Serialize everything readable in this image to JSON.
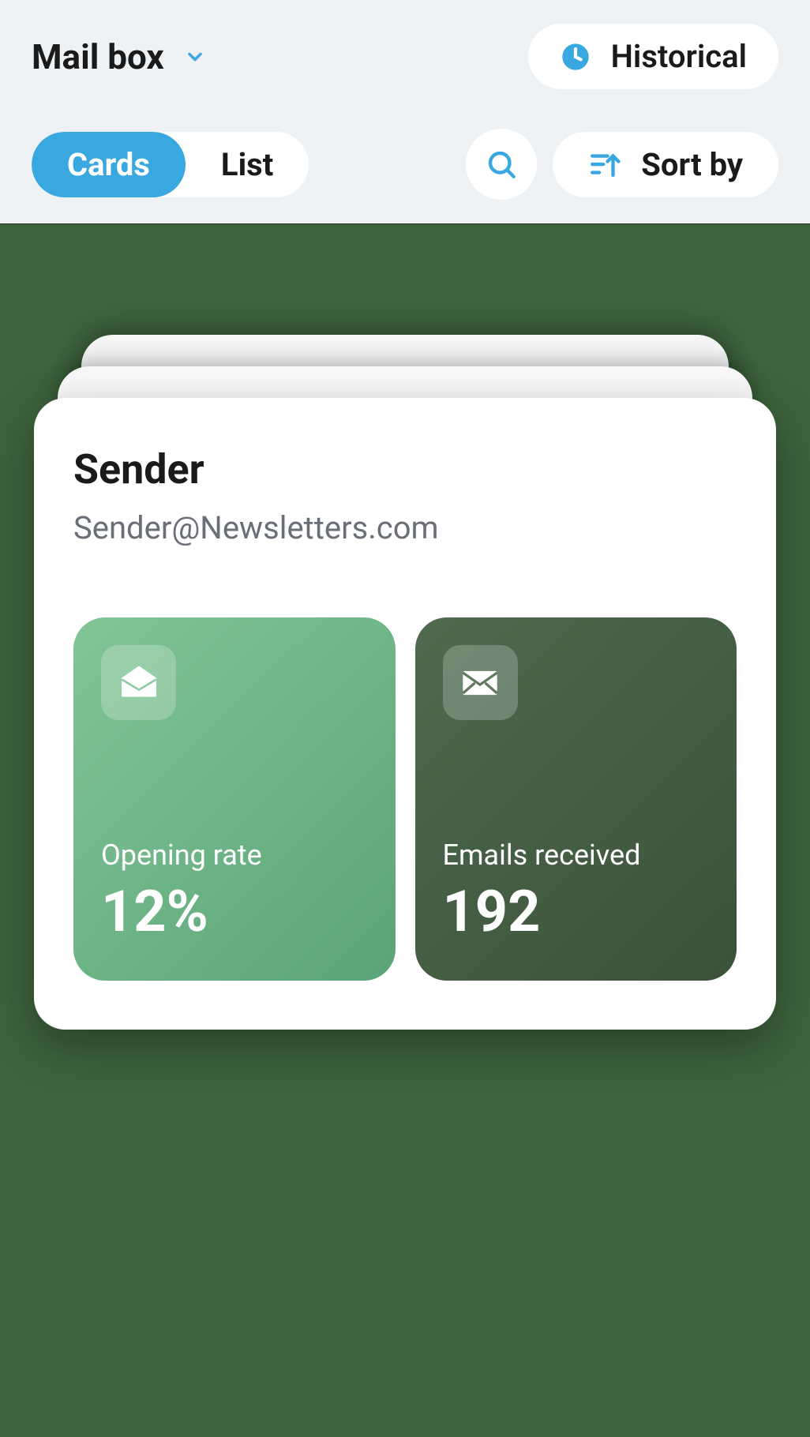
{
  "header": {
    "mailbox_label": "Mail box",
    "historical_label": "Historical",
    "view_cards": "Cards",
    "view_list": "List",
    "sort_label": "Sort by"
  },
  "card": {
    "title": "Sender",
    "email": "Sender@Newsletters.com",
    "tiles": [
      {
        "label": "Opening rate",
        "value": "12%"
      },
      {
        "label": "Emails received",
        "value": "192"
      }
    ]
  },
  "colors": {
    "accent": "#39a7e0",
    "bg_dark": "#3e633d"
  }
}
